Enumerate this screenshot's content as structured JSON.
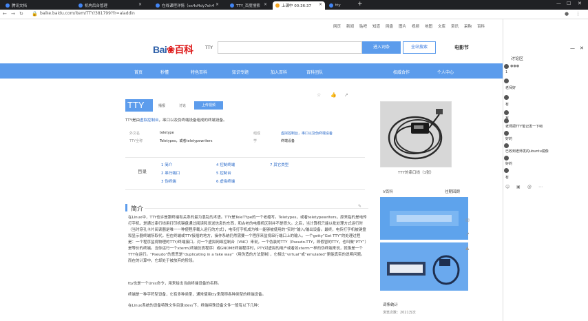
{
  "browser": {
    "tabs": [
      {
        "label": "腾讯文档"
      },
      {
        "label": "机构后台管理"
      },
      {
        "label": "在线课程详情（ex4d4dy7eh4"
      },
      {
        "label": "TTY_百度搜索"
      },
      {
        "label": "上课中 00:36:37"
      },
      {
        "label": "tty"
      }
    ],
    "new_tab": "+",
    "url": "baike.baidu.com/item/TTY/381799?fr=aladdin"
  },
  "topnav": [
    "网页",
    "新闻",
    "贴吧",
    "知道",
    "网盘",
    "图片",
    "视频",
    "地图",
    "文库",
    "资讯",
    "采购",
    "百科"
  ],
  "topright": {
    "user": "百度首页",
    "msg": "消息"
  },
  "header": {
    "logo_text": "Bai",
    "logo_text2": "百科",
    "product": "TTY",
    "btn_enter": "进入词条",
    "btn_search": "全站搜索",
    "film": "电影节"
  },
  "bluenav": [
    "首页",
    "秒懂",
    "特色百科",
    "知识专题",
    "加入百科",
    "百科团队",
    "权威合作",
    "个人中心"
  ],
  "entry": {
    "title": "TTY",
    "tag1": "播报",
    "tag2": "讨论",
    "edit": "上传视频",
    "lead_pre": "TTY是由",
    "lead_link": "虚拟控制台",
    "lead_post": "，串口以及伪终端设备组成的终端设备。",
    "info": [
      {
        "label": "外文名",
        "value": "teletype"
      },
      {
        "label": "TTY全称",
        "value": "Teletypes，或者teletypewriters"
      },
      {
        "label": "组成",
        "value": "虚拟控制台，串口以及伪终端设备"
      },
      {
        "label": "学",
        "value": "终端设备"
      }
    ]
  },
  "toc": {
    "label": "目录",
    "items": [
      "1 简介",
      "2 串行端口",
      "3 伪终端",
      "4 控制终端",
      "5 控制台",
      "6 虚拟终端",
      "7 其它类型"
    ]
  },
  "section": {
    "title": "简介",
    "paras": [
      "在Linux中，TTY也许是跟终端有关系的最为混乱的术语。TTY是TeleTYpe的一个老缩写。Teletypes，或者teletypewriters，原来指的是电传打字机，是通过串行线用打印机键盘通过阅读和发送信息的东西，和古老的电报机区别并不是很大。之后，当计算机只能以批处理方式运行时（当时穿孔卡片阅读器是唯一一种使程序载入运行的方式），电传打字机成为唯一能够被使用的“实时”输入/输出设备。最终，电传打字机被键盘和显示器终端所取代，但在终端或TTY接插的地方，操作系统仍然需要一个程序来监视串行端口上的输入。一个getty“Get TTY”的处理过程是：一个程序监视物理的TTY/终端接口。对一个虚拟网络控制台（VNC）来说，一个伪装的TTY（Pseudo-TTY，即假冒的TTY，也叫做“PTY”）是等价的终端。当你运行一个xterm(终端仿真程序）或GNOME终端程序时，PTY对虚拟的用户或者如xterm一样的伪终端来说，就像是一个TTY在运行。“Pseudo”的意思是“duplicating in a fake way”（用伪造的方法复制），它相比“virtual”或“emulated”更能真实的说明问题。而在的计算中，它却处于被放弃的阶段。",
      "tty也是一个Unix命令，用来给出当前终端设备的名称。",
      "终端是一种字符型设备，它有多种类型，通常使用tty来简称各种类型的终端设备。",
      "在Linux系统的设备特殊文件目录/dev/下，终端特殊设备文件一般有以下几种："
    ]
  },
  "side": {
    "photo_caption": "TTY的串口线（1张）",
    "tabs": [
      "V百科",
      "往期回顾"
    ],
    "meta_title": "词条统计",
    "meta_sub": "浏览次数：2021万次"
  },
  "chat": {
    "title": "讨论区",
    "messages": [
      {
        "text": "1"
      },
      {
        "text": "老师好"
      },
      {
        "text": "有"
      },
      {
        "text": "有"
      },
      {
        "text": "老师把TTY笔记发一下吧"
      },
      {
        "text": "好的"
      },
      {
        "text": "已收到老师发的ubuntu镜像"
      },
      {
        "text": "好的"
      },
      {
        "text": "有"
      }
    ],
    "footer_icons": [
      "emoji",
      "image",
      "at",
      "more"
    ]
  }
}
